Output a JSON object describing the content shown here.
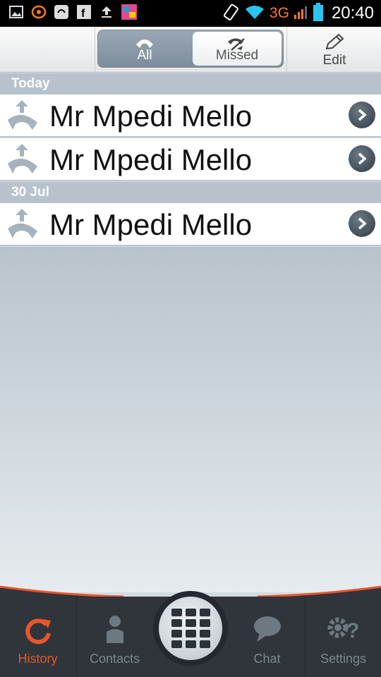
{
  "status_bar": {
    "network": "3G",
    "time": "20:40"
  },
  "toolbar": {
    "tab_all": "All",
    "tab_missed": "Missed",
    "edit": "Edit"
  },
  "sections": [
    {
      "header": "Today",
      "rows": [
        "Mr Mpedi Mello",
        "Mr Mpedi Mello"
      ]
    },
    {
      "header": "30 Jul",
      "rows": [
        "Mr Mpedi Mello"
      ]
    }
  ],
  "nav": {
    "history": "History",
    "contacts": "Contacts",
    "chat": "Chat",
    "settings": "Settings",
    "active_color": "#e8562a"
  },
  "icons": [
    "image-icon",
    "app-icon",
    "facebook-icon",
    "upload-icon",
    "app-thumbnail-icon",
    "rotate-icon",
    "wifi-icon",
    "signal-icon",
    "battery-icon",
    "phone-icon",
    "missed-call-icon",
    "pencil-icon",
    "outgoing-call-icon",
    "chevron-right-icon",
    "refresh-icon",
    "person-icon",
    "chat-bubble-icon",
    "gear-question-icon",
    "dialpad-icon"
  ]
}
